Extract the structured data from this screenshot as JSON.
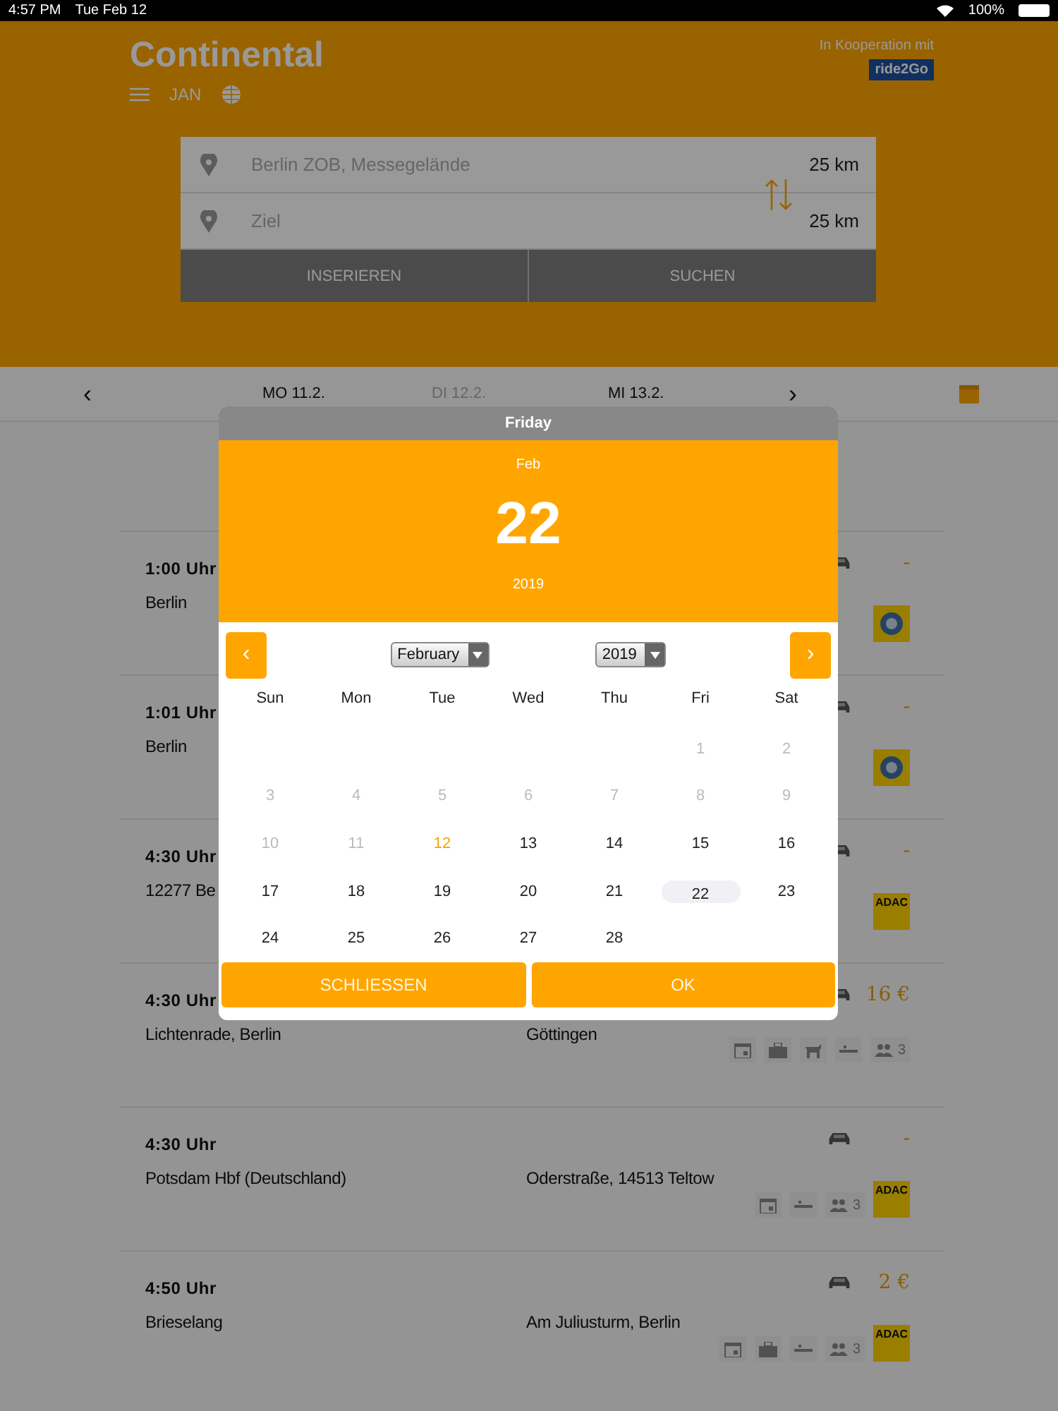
{
  "status_bar": {
    "time": "4:57 PM",
    "date": "Tue Feb 12",
    "battery": "100%"
  },
  "header": {
    "title": "Continental",
    "user": "JAN",
    "partner_caption": "In Kooperation mit",
    "partner_badge": "ride2Go"
  },
  "search": {
    "from": {
      "placeholder": "Berlin ZOB, Messegelände",
      "radius": "25 km"
    },
    "to": {
      "placeholder": "Ziel",
      "radius": "25 km"
    },
    "buttons": [
      "INSERIEREN",
      "SUCHEN"
    ]
  },
  "date_nav": {
    "prev": "‹",
    "next": "›",
    "days": [
      {
        "label": "MO 11.2.",
        "selected": false
      },
      {
        "label": "DI 12.2.",
        "selected": true
      },
      {
        "label": "MI 13.2.",
        "selected": false
      }
    ]
  },
  "rides": [
    {
      "time": "1:00 Uhr",
      "from": "Berlin",
      "price": "-",
      "badges": [
        {
          "kind": "tcs"
        }
      ]
    },
    {
      "time": "1:01 Uhr",
      "from": "Berlin",
      "price": "-",
      "badges": [
        {
          "kind": "tcs"
        }
      ]
    },
    {
      "time": "4:30 Uhr",
      "from": "12277 Be",
      "price": "-",
      "badges": [
        {
          "kind": "adac",
          "label": "ADAC"
        }
      ]
    },
    {
      "time": "4:30 Uhr",
      "from": "Lichtenrade, Berlin",
      "to": "Göttingen",
      "price": "16 €",
      "badges": [
        {
          "kind": "calendar"
        },
        {
          "kind": "luggage"
        },
        {
          "kind": "dog"
        },
        {
          "kind": "dash"
        },
        {
          "kind": "people",
          "count": "3"
        }
      ]
    },
    {
      "time": "4:30 Uhr",
      "from": "Potsdam Hbf (Deutschland)",
      "to": "Oderstraße, 14513 Teltow",
      "price": "-",
      "badges": [
        {
          "kind": "calendar"
        },
        {
          "kind": "dash"
        },
        {
          "kind": "people",
          "count": "3"
        },
        {
          "kind": "adac",
          "label": "ADAC"
        }
      ]
    },
    {
      "time": "4:50 Uhr",
      "from": "Brieselang",
      "to": "Am Juliusturm, Berlin",
      "price": "2 €",
      "badges": [
        {
          "kind": "calendar"
        },
        {
          "kind": "luggage"
        },
        {
          "kind": "dash"
        },
        {
          "kind": "people",
          "count": "3"
        },
        {
          "kind": "adac",
          "label": "ADAC"
        }
      ]
    }
  ],
  "date_picker": {
    "weekday": "Friday",
    "month": "Feb",
    "day": "22",
    "year": "2019",
    "prev": "‹",
    "next": "›",
    "month_select": "February",
    "year_select": "2019",
    "weekdays": [
      "Sun",
      "Mon",
      "Tue",
      "Wed",
      "Thu",
      "Fri",
      "Sat"
    ],
    "weeks": [
      [
        {
          "kind": "blank"
        },
        {
          "kind": "blank"
        },
        {
          "kind": "blank"
        },
        {
          "kind": "blank"
        },
        {
          "kind": "blank"
        },
        {
          "label": "1",
          "disabled": true,
          "today": false,
          "selected": false
        },
        {
          "label": "2",
          "disabled": true,
          "today": false,
          "selected": false
        }
      ],
      [
        {
          "label": "3",
          "disabled": true,
          "today": false,
          "selected": false
        },
        {
          "label": "4",
          "disabled": true,
          "today": false,
          "selected": false
        },
        {
          "label": "5",
          "disabled": true,
          "today": false,
          "selected": false
        },
        {
          "label": "6",
          "disabled": true,
          "today": false,
          "selected": false
        },
        {
          "label": "7",
          "disabled": true,
          "today": false,
          "selected": false
        },
        {
          "label": "8",
          "disabled": true,
          "today": false,
          "selected": false
        },
        {
          "label": "9",
          "disabled": true,
          "today": false,
          "selected": false
        }
      ],
      [
        {
          "label": "10",
          "disabled": true,
          "today": false,
          "selected": false
        },
        {
          "label": "11",
          "disabled": true,
          "today": false,
          "selected": false
        },
        {
          "label": "12",
          "disabled": false,
          "today": true,
          "selected": false
        },
        {
          "label": "13",
          "disabled": false,
          "today": false,
          "selected": false
        },
        {
          "label": "14",
          "disabled": false,
          "today": false,
          "selected": false
        },
        {
          "label": "15",
          "disabled": false,
          "today": false,
          "selected": false
        },
        {
          "label": "16",
          "disabled": false,
          "today": false,
          "selected": false
        }
      ],
      [
        {
          "label": "17",
          "disabled": false,
          "today": false,
          "selected": false
        },
        {
          "label": "18",
          "disabled": false,
          "today": false,
          "selected": false
        },
        {
          "label": "19",
          "disabled": false,
          "today": false,
          "selected": false
        },
        {
          "label": "20",
          "disabled": false,
          "today": false,
          "selected": false
        },
        {
          "label": "21",
          "disabled": false,
          "today": false,
          "selected": false
        },
        {
          "label": "22",
          "disabled": false,
          "today": false,
          "selected": true
        },
        {
          "label": "23",
          "disabled": false,
          "today": false,
          "selected": false
        }
      ],
      [
        {
          "label": "24",
          "disabled": false,
          "today": false,
          "selected": false
        },
        {
          "label": "25",
          "disabled": false,
          "today": false,
          "selected": false
        },
        {
          "label": "26",
          "disabled": false,
          "today": false,
          "selected": false
        },
        {
          "label": "27",
          "disabled": false,
          "today": false,
          "selected": false
        },
        {
          "label": "28",
          "disabled": false,
          "today": false,
          "selected": false
        },
        {
          "kind": "blank"
        },
        {
          "kind": "blank"
        }
      ]
    ],
    "buttons": [
      "SCHLIESSEN",
      "OK"
    ]
  }
}
